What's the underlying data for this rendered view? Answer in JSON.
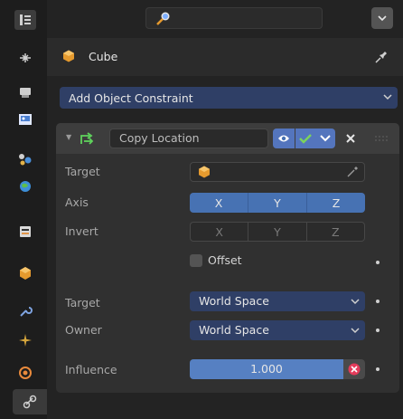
{
  "tabs": [
    {
      "name": "tool-tab",
      "icon": "tool-icon"
    },
    {
      "name": "render-tab",
      "icon": "render-icon"
    },
    {
      "name": "output-tab",
      "icon": "printer-icon"
    },
    {
      "name": "view-layer-tab",
      "icon": "image-icon"
    },
    {
      "name": "scene-tab",
      "icon": "scene-icon"
    },
    {
      "name": "world-tab",
      "icon": "world-icon"
    },
    {
      "name": "collection-tab",
      "icon": "collection-icon"
    },
    {
      "name": "object-tab",
      "icon": "cube-icon"
    },
    {
      "name": "modifier-tab",
      "icon": "wrench-icon"
    },
    {
      "name": "particles-tab",
      "icon": "particles-icon"
    },
    {
      "name": "physics-tab",
      "icon": "physics-icon"
    },
    {
      "name": "constraints-tab",
      "icon": "constraint-icon",
      "active": true
    }
  ],
  "header": {
    "search_icon": "search-icon",
    "options_icon": "chevron-down-icon"
  },
  "object": {
    "name": "Cube",
    "icon": "cube-icon",
    "pin_icon": "pin-icon"
  },
  "add_constraint": {
    "label": "Add Object Constraint"
  },
  "constraint": {
    "name": "Copy Location",
    "enabled": true,
    "target": {
      "label": "Target",
      "value": ""
    },
    "axis": {
      "label": "Axis",
      "options": [
        "X",
        "Y",
        "Z"
      ],
      "active": [
        true,
        true,
        true
      ]
    },
    "invert": {
      "label": "Invert",
      "options": [
        "X",
        "Y",
        "Z"
      ],
      "active": [
        false,
        false,
        false
      ]
    },
    "offset": {
      "label": "Offset",
      "checked": false
    },
    "target_space": {
      "label": "Target",
      "value": "World Space"
    },
    "owner_space": {
      "label": "Owner",
      "value": "World Space"
    },
    "influence": {
      "label": "Influence",
      "value": "1.000",
      "fraction": 1.0
    }
  },
  "colors": {
    "accent": "#4772b3",
    "dropdown": "#2f3f66",
    "check": "#7cd35c",
    "remove": "#e43b5a"
  }
}
